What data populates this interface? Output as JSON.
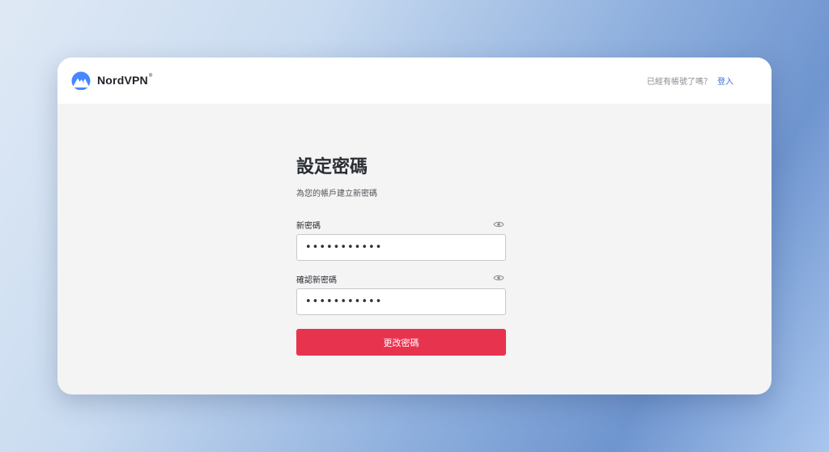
{
  "header": {
    "logo_text": "NordVPN",
    "logo_mark": "®",
    "account_question": "已經有帳號了嗎？",
    "login_link": "登入"
  },
  "form": {
    "title": "設定密碼",
    "subtitle": "為您的帳戶建立新密碼",
    "new_password_label": "新密碼",
    "new_password_value": "•••••••••••",
    "confirm_password_label": "確認新密碼",
    "confirm_password_value": "•••••••••••",
    "submit_label": "更改密碼"
  },
  "icons": {
    "logo": "nordvpn-mountain-icon",
    "show_password": "eye-icon"
  },
  "colors": {
    "accent": "#e8334f",
    "link": "#3e6fd6",
    "brand": "#4687ff"
  }
}
